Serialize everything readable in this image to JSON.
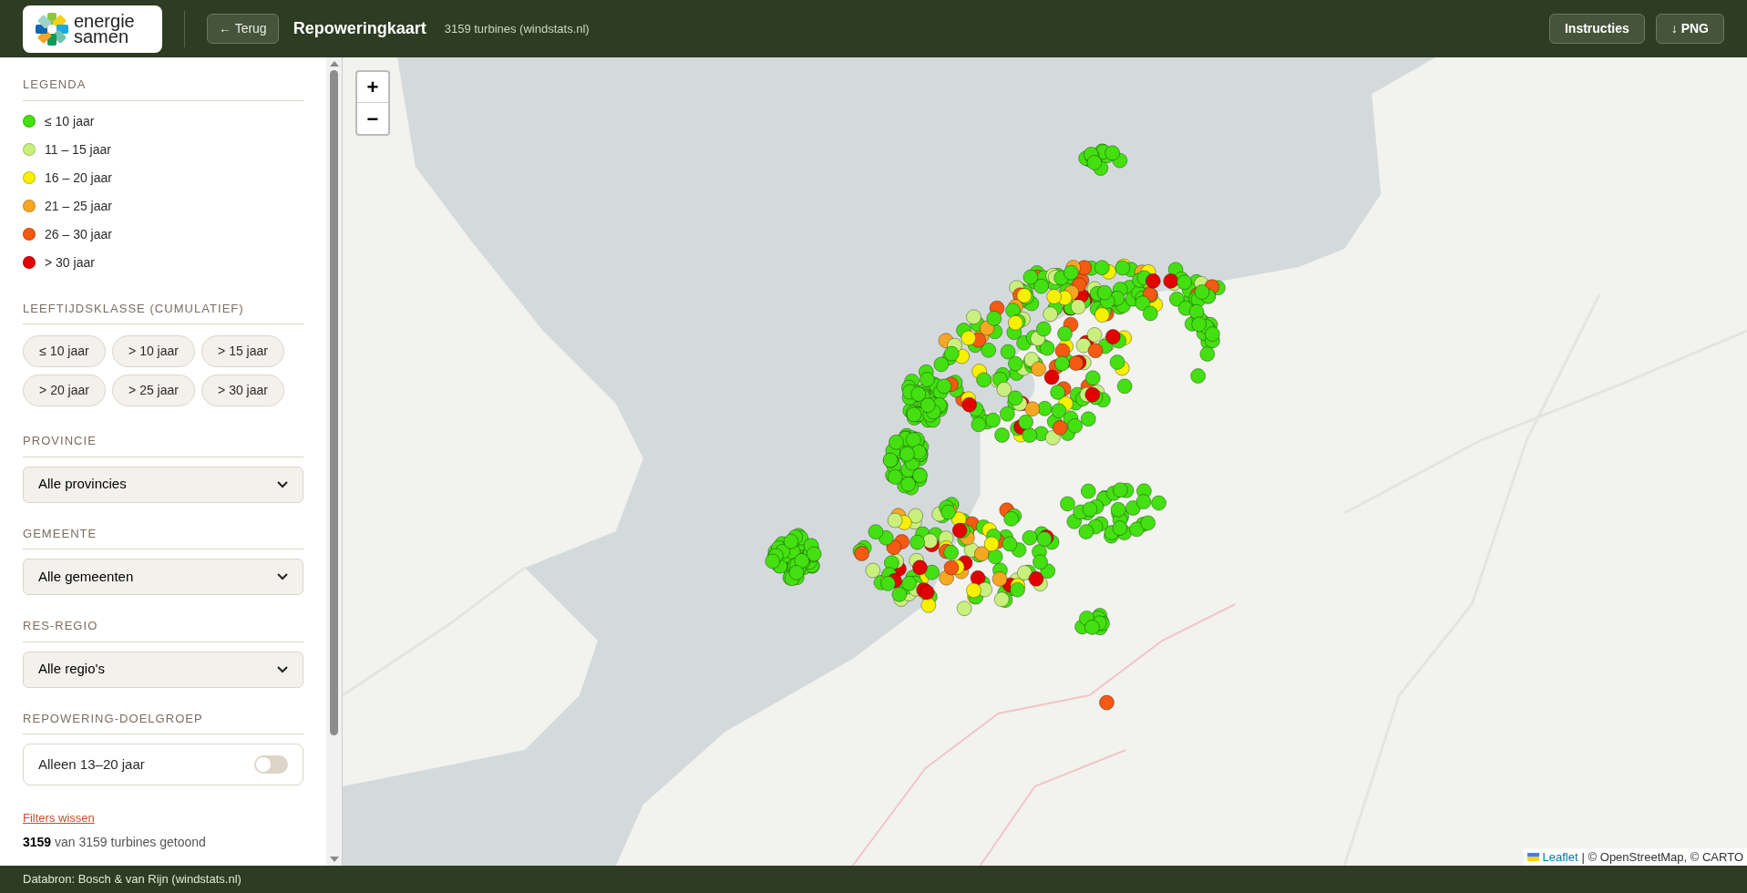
{
  "header": {
    "logo_text": [
      "energie",
      "samen"
    ],
    "back_button": "← Terug",
    "title": "Repoweringkaart",
    "subtitle": "3159 turbines (windstats.nl)",
    "buttons": [
      "Instructies",
      "↓ PNG"
    ]
  },
  "sidebar": {
    "legend": {
      "title": "LEGENDA",
      "items": [
        {
          "label": "≤ 10 jaar",
          "color": "#44e011"
        },
        {
          "label": "11 – 15 jaar",
          "color": "#c9f07c"
        },
        {
          "label": "16 – 20 jaar",
          "color": "#f7f000"
        },
        {
          "label": "21 – 25 jaar",
          "color": "#f7a823"
        },
        {
          "label": "26 – 30 jaar",
          "color": "#f55a12"
        },
        {
          "label": "> 30 jaar",
          "color": "#e30000"
        }
      ]
    },
    "age_filter": {
      "title": "LEEFTIJDSKLASSE (CUMULATIEF)",
      "chips": [
        {
          "label": "≤ 10 jaar",
          "selected": false
        },
        {
          "label": "> 10 jaar",
          "selected": false
        },
        {
          "label": "> 15 jaar",
          "selected": false
        },
        {
          "label": "> 20 jaar",
          "selected": false
        },
        {
          "label": "> 25 jaar",
          "selected": false
        },
        {
          "label": "> 30 jaar",
          "selected": false
        }
      ]
    },
    "selects": [
      {
        "title": "PROVINCIE",
        "value": "Alle provincies"
      },
      {
        "title": "GEMEENTE",
        "value": "Alle gemeenten"
      },
      {
        "title": "RES-REGIO",
        "value": "Alle regio's"
      }
    ],
    "target_group": {
      "title": "REPOWERING-DOELGROEP",
      "label": "Alleen 13–20 jaar",
      "on": false
    },
    "clear_link": "Filters wissen",
    "count_text": "**3159** van 3159 turbines getoond"
  },
  "map": {
    "zoom_buttons": [
      "+",
      "−"
    ],
    "attribution": {
      "link": "Leaflet",
      "text": "| © OpenStreetMap, © CARTO"
    }
  },
  "footer": "Databron: Bosch & van Rijn (windstats.nl)"
}
